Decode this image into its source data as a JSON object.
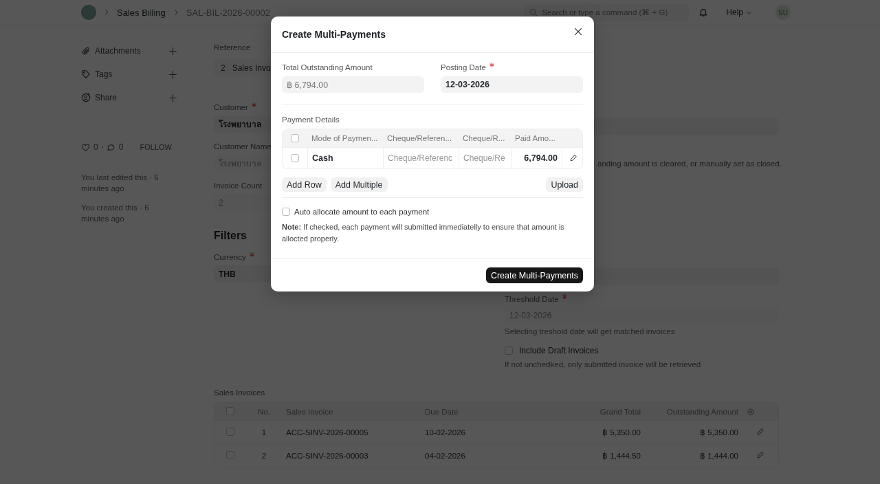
{
  "navbar": {
    "breadcrumbs": [
      "Sales Billing",
      "SAL-BIL-2026-00002"
    ],
    "search": {
      "placeholder": "Search or type a command (⌘ + G)"
    },
    "help": "Help",
    "avatar": "SU"
  },
  "sidebar": {
    "items": [
      {
        "kind": "attachment",
        "label": "Attachments"
      },
      {
        "kind": "tag",
        "label": "Tags"
      },
      {
        "kind": "share",
        "label": "Share"
      }
    ],
    "likes": "0",
    "comments": "0",
    "follow": "FOLLOW",
    "activity": [
      "You last edited this · 6 minutes ago",
      "You created this · 6 minutes ago"
    ]
  },
  "form": {
    "reference": {
      "label": "Reference",
      "count": "2",
      "value": "Sales Invo"
    },
    "fields": [
      {
        "label": "Customer",
        "required": true,
        "value": "โรงพยาบาล",
        "kind": "link"
      },
      {
        "label": "Customer Name",
        "required": false,
        "value": "โรงพยาบาล",
        "kind": "readonly"
      },
      {
        "label": "Invoice Count",
        "required": false,
        "value": "2",
        "kind": "readonly"
      }
    ],
    "closed_note": "anding amount is cleared, or manually set as closed.",
    "filters_title": "Filters",
    "currency": {
      "label": "Currency",
      "required": true,
      "value": "THB"
    },
    "threshold_date": {
      "label": "Threshold Date",
      "required": true,
      "value": "12-03-2026",
      "description": "Selecting treshold date will get matched invoices"
    },
    "include_draft": {
      "label": "Include Draft Invoices",
      "checked": false,
      "description": "If not unchedked, only submtted invoice will be retrieved"
    }
  },
  "sales_invoices": {
    "title": "Sales Invoices",
    "all_selected": false,
    "columns": [
      "No.",
      "Sales Invoice",
      "Due Date",
      "Grand Total",
      "Outstanding Amount"
    ],
    "rows": [
      {
        "selected": false,
        "no": "1",
        "invoice": "ACC-SINV-2026-00005",
        "due_date": "10-02-2026",
        "grand_total": "฿ 5,350.00",
        "outstanding": "฿ 5,350.00"
      },
      {
        "selected": false,
        "no": "2",
        "invoice": "ACC-SINV-2026-00003",
        "due_date": "04-02-2026",
        "grand_total": "฿ 1,444.50",
        "outstanding": "฿ 1,444.00"
      }
    ]
  },
  "dialog": {
    "title": "Create Multi-Payments",
    "total_outstanding": {
      "label": "Total Outstanding Amount",
      "value": "฿ 6,794.00"
    },
    "posting_date": {
      "label": "Posting Date",
      "required": true,
      "value": "12-03-2026"
    },
    "payment_details": {
      "label": "Payment Details",
      "all_selected": false,
      "columns": [
        "Mode of Paymen...",
        "Cheque/Referen...",
        "Cheque/R...",
        "Paid Amo..."
      ],
      "rows": [
        {
          "selected": false,
          "mode": "Cash",
          "reference_no": {
            "placeholder": "Cheque/Referenc"
          },
          "reference_date": {
            "placeholder": "Cheque/Re"
          },
          "paid_amount": "6,794.00"
        }
      ]
    },
    "grid_buttons": [
      "Add Row",
      "Add Multiple"
    ],
    "upload": "Upload",
    "auto_allocate": {
      "label": "Auto allocate amount to each payment",
      "checked": false
    },
    "note": "**Note:** If checked, each payment will submitted immediatelly to ensure that amount is allocted properly.",
    "primary_button": "Create Multi-Payments"
  }
}
